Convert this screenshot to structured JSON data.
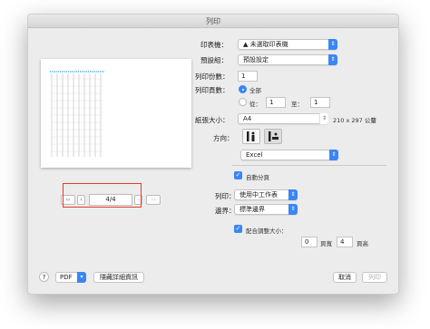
{
  "window": {
    "title": "列印"
  },
  "preview": {
    "page_indicator": "4/4"
  },
  "nav": {
    "first": "‹‹",
    "prev": "‹",
    "next": "›",
    "last": "››"
  },
  "printer": {
    "label": "印表機：",
    "value": "▲ 未選取印表機"
  },
  "presets": {
    "label": "預設組：",
    "value": "預設設定"
  },
  "copies": {
    "label": "列印份數：",
    "value": "1"
  },
  "pages": {
    "label": "列印頁數：",
    "all_label": "全部",
    "from_label": "從：",
    "from_value": "1",
    "to_label": "至：",
    "to_value": "1"
  },
  "paper": {
    "label": "紙張大小：",
    "value": "A4",
    "dimensions": "210 x 297 公釐"
  },
  "orientation": {
    "label": "方向：",
    "selected": "landscape"
  },
  "app_section": {
    "value": "Excel"
  },
  "auto_collate": {
    "label": "自動分頁",
    "checked": true
  },
  "print_what": {
    "label": "列印：",
    "value": "使用中工作表"
  },
  "margins": {
    "label": "邊界：",
    "value": "標準邊界"
  },
  "fit": {
    "label": "配合調整大小：",
    "checked": true,
    "pages_wide": "0",
    "pages_wide_label": "頁寬",
    "pages_tall": "4",
    "pages_tall_label": "頁高"
  },
  "footer": {
    "help": "?",
    "pdf_label": "PDF",
    "hide_details": "隱藏詳細資訊",
    "cancel": "取消",
    "print": "列印"
  }
}
